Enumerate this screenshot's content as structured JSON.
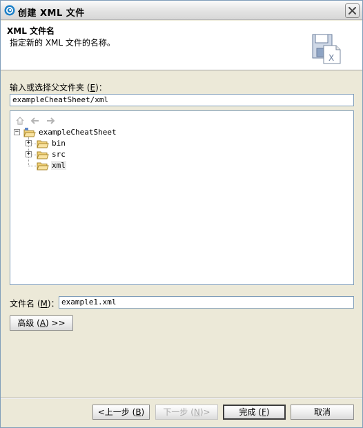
{
  "window": {
    "title": "创建 XML 文件",
    "icon": "eclipse-icon"
  },
  "header": {
    "title": "XML 文件名",
    "description": "指定新的 XML 文件的名称。",
    "icon": "xml-file-wizard-icon"
  },
  "parent_folder": {
    "label_prefix": "输入或选择父文件夹 (",
    "label_mnemonic": "E",
    "label_suffix": ")：",
    "value": "exampleCheatSheet/xml"
  },
  "tree": {
    "toolbar": [
      "home-icon",
      "back-icon",
      "forward-icon"
    ],
    "root": {
      "label": "exampleCheatSheet",
      "expanded": true
    },
    "children": [
      {
        "label": "bin",
        "expandable": true
      },
      {
        "label": "src",
        "expandable": true
      },
      {
        "label": "xml",
        "expandable": false,
        "selected": true
      }
    ]
  },
  "file_name": {
    "label_prefix": "文件名 (",
    "label_mnemonic": "M",
    "label_suffix": ")：",
    "value": "example1.xml"
  },
  "buttons": {
    "advanced_prefix": "高级 (",
    "advanced_mnemonic": "A",
    "advanced_suffix": ") >>",
    "back_prefix": "<上一步 (",
    "back_mnemonic": "B",
    "back_suffix": ")",
    "next_prefix": "下一步 (",
    "next_mnemonic": "N",
    "next_suffix": ")>",
    "finish_prefix": "完成 (",
    "finish_mnemonic": "F",
    "finish_suffix": ")",
    "cancel": "取消"
  }
}
